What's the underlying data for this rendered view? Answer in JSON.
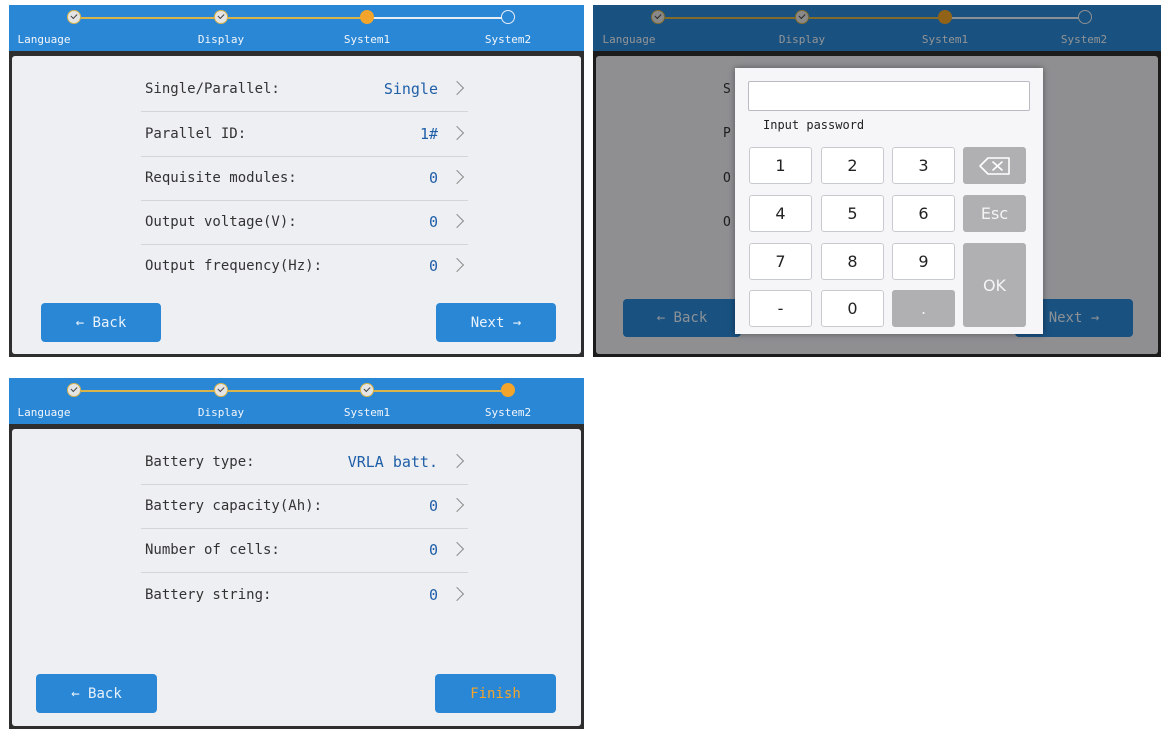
{
  "steps": [
    "Language",
    "Display",
    "System1",
    "System2"
  ],
  "screen1": {
    "rows": [
      {
        "label": "Single/Parallel:",
        "value": "Single"
      },
      {
        "label": "Parallel ID:",
        "value": "1#"
      },
      {
        "label": "Requisite modules:",
        "value": "0"
      },
      {
        "label": "Output voltage(V):",
        "value": "0"
      },
      {
        "label": "Output frequency(Hz):",
        "value": "0"
      }
    ],
    "back_label": "← Back",
    "next_label": "Next →"
  },
  "screen2": {
    "row_initials": [
      "S",
      "P",
      "O",
      "O"
    ],
    "password_label": "Input password",
    "keys": {
      "k1": "1",
      "k2": "2",
      "k3": "3",
      "k4": "4",
      "k5": "5",
      "k6": "6",
      "k7": "7",
      "k8": "8",
      "k9": "9",
      "minus": "-",
      "k0": "0",
      "dot": ".",
      "esc": "Esc",
      "ok": "OK",
      "backspace_icon": "backspace-icon"
    },
    "back_label": "← Back",
    "next_label": "Next →"
  },
  "screen3": {
    "rows": [
      {
        "label": "Battery type:",
        "value": "VRLA batt."
      },
      {
        "label": "Battery capacity(Ah):",
        "value": "0"
      },
      {
        "label": "Number of cells:",
        "value": "0"
      },
      {
        "label": "Battery string:",
        "value": "0"
      }
    ],
    "back_label": "← Back",
    "finish_label": "Finish"
  },
  "colors": {
    "header_blue": "#2a87d6",
    "current_step": "#f2a52a",
    "value_blue": "#1f5fa8",
    "finish_text": "#f2a52a"
  }
}
